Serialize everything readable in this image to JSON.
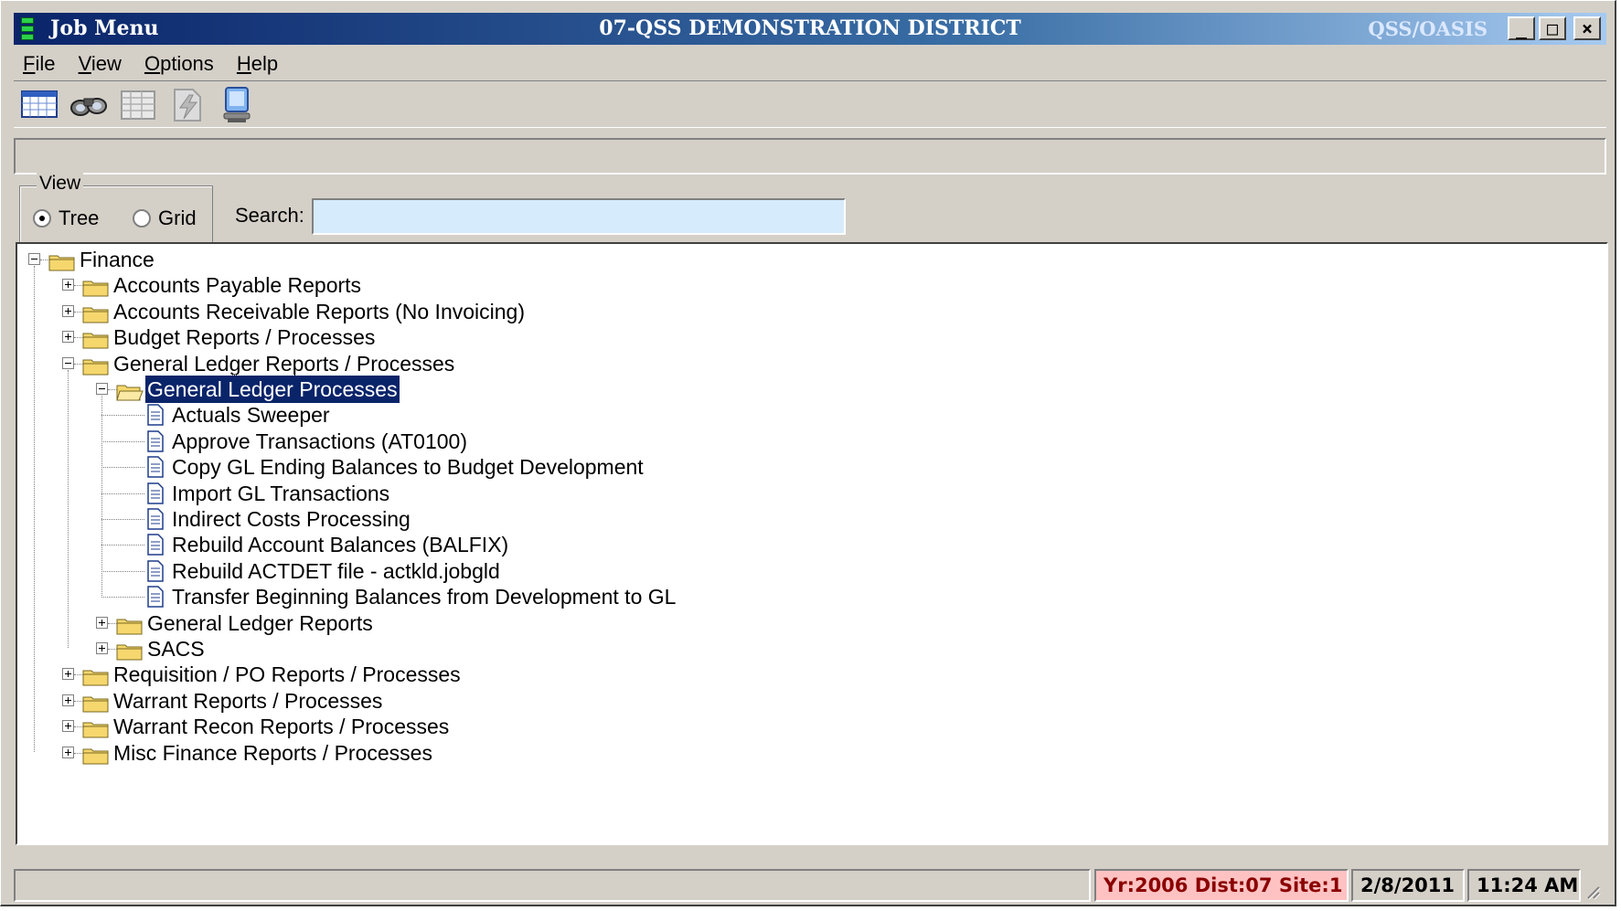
{
  "window": {
    "title_left": "Job Menu",
    "title_center": "07-QSS DEMONSTRATION DISTRICT",
    "title_right": "QSS/OASIS",
    "min_glyph": "_",
    "max_glyph": "□",
    "close_glyph": "×"
  },
  "menu": [
    {
      "label": "File"
    },
    {
      "label": "View"
    },
    {
      "label": "Options"
    },
    {
      "label": "Help"
    }
  ],
  "toolbar": {
    "icons": [
      "calendar-grid-icon",
      "binoculars-icon",
      "spreadsheet-icon",
      "lightning-document-icon",
      "computer-monitor-icon"
    ]
  },
  "view": {
    "legend": "View",
    "options": [
      {
        "label": "Tree",
        "selected": true
      },
      {
        "label": "Grid",
        "selected": false
      }
    ]
  },
  "search": {
    "label": "Search:",
    "value": "",
    "placeholder": ""
  },
  "tree": [
    {
      "label": "Finance",
      "level": 0,
      "type": "folder",
      "state": "expanded",
      "selected": false
    },
    {
      "label": "Accounts Payable Reports",
      "level": 1,
      "type": "folder",
      "state": "collapsed",
      "selected": false
    },
    {
      "label": "Accounts Receivable Reports (No Invoicing)",
      "level": 1,
      "type": "folder",
      "state": "collapsed",
      "selected": false
    },
    {
      "label": "Budget Reports / Processes",
      "level": 1,
      "type": "folder",
      "state": "collapsed",
      "selected": false
    },
    {
      "label": "General Ledger Reports / Processes",
      "level": 1,
      "type": "folder",
      "state": "expanded",
      "selected": false
    },
    {
      "label": "General Ledger Processes",
      "level": 2,
      "type": "folder",
      "state": "expanded",
      "selected": true
    },
    {
      "label": "Actuals Sweeper",
      "level": 3,
      "type": "document",
      "state": "leaf",
      "selected": false
    },
    {
      "label": "Approve Transactions (AT0100)",
      "level": 3,
      "type": "document",
      "state": "leaf",
      "selected": false
    },
    {
      "label": "Copy GL Ending Balances to Budget Development",
      "level": 3,
      "type": "document",
      "state": "leaf",
      "selected": false
    },
    {
      "label": "Import GL Transactions",
      "level": 3,
      "type": "document",
      "state": "leaf",
      "selected": false
    },
    {
      "label": "Indirect Costs Processing",
      "level": 3,
      "type": "document",
      "state": "leaf",
      "selected": false
    },
    {
      "label": "Rebuild Account Balances (BALFIX)",
      "level": 3,
      "type": "document",
      "state": "leaf",
      "selected": false
    },
    {
      "label": "Rebuild ACTDET file - actkld.jobgld",
      "level": 3,
      "type": "document",
      "state": "leaf",
      "selected": false
    },
    {
      "label": "Transfer Beginning Balances from Development to GL",
      "level": 3,
      "type": "document",
      "state": "leaf",
      "selected": false
    },
    {
      "label": "General Ledger Reports",
      "level": 2,
      "type": "folder",
      "state": "collapsed",
      "selected": false
    },
    {
      "label": "SACS",
      "level": 2,
      "type": "folder",
      "state": "collapsed",
      "selected": false
    },
    {
      "label": "Requisition / PO Reports / Processes",
      "level": 1,
      "type": "folder",
      "state": "collapsed",
      "selected": false
    },
    {
      "label": "Warrant Reports / Processes",
      "level": 1,
      "type": "folder",
      "state": "collapsed",
      "selected": false
    },
    {
      "label": "Warrant Recon Reports / Processes",
      "level": 1,
      "type": "folder",
      "state": "collapsed",
      "selected": false
    },
    {
      "label": "Misc Finance Reports / Processes",
      "level": 1,
      "type": "folder",
      "state": "collapsed",
      "selected": false
    }
  ],
  "statusbar": {
    "context": "Yr:2006  Dist:07  Site:1",
    "date": "2/8/2011",
    "time": "11:24 AM"
  },
  "colors": {
    "titlebar_start": "#0a246a",
    "titlebar_end": "#a6caf0",
    "search_background": "#d6ebfb",
    "selection": "#0a246a",
    "status_context_background": "#ffc2c2",
    "status_context_text": "#8b0000",
    "folder": "#f5d76e"
  }
}
